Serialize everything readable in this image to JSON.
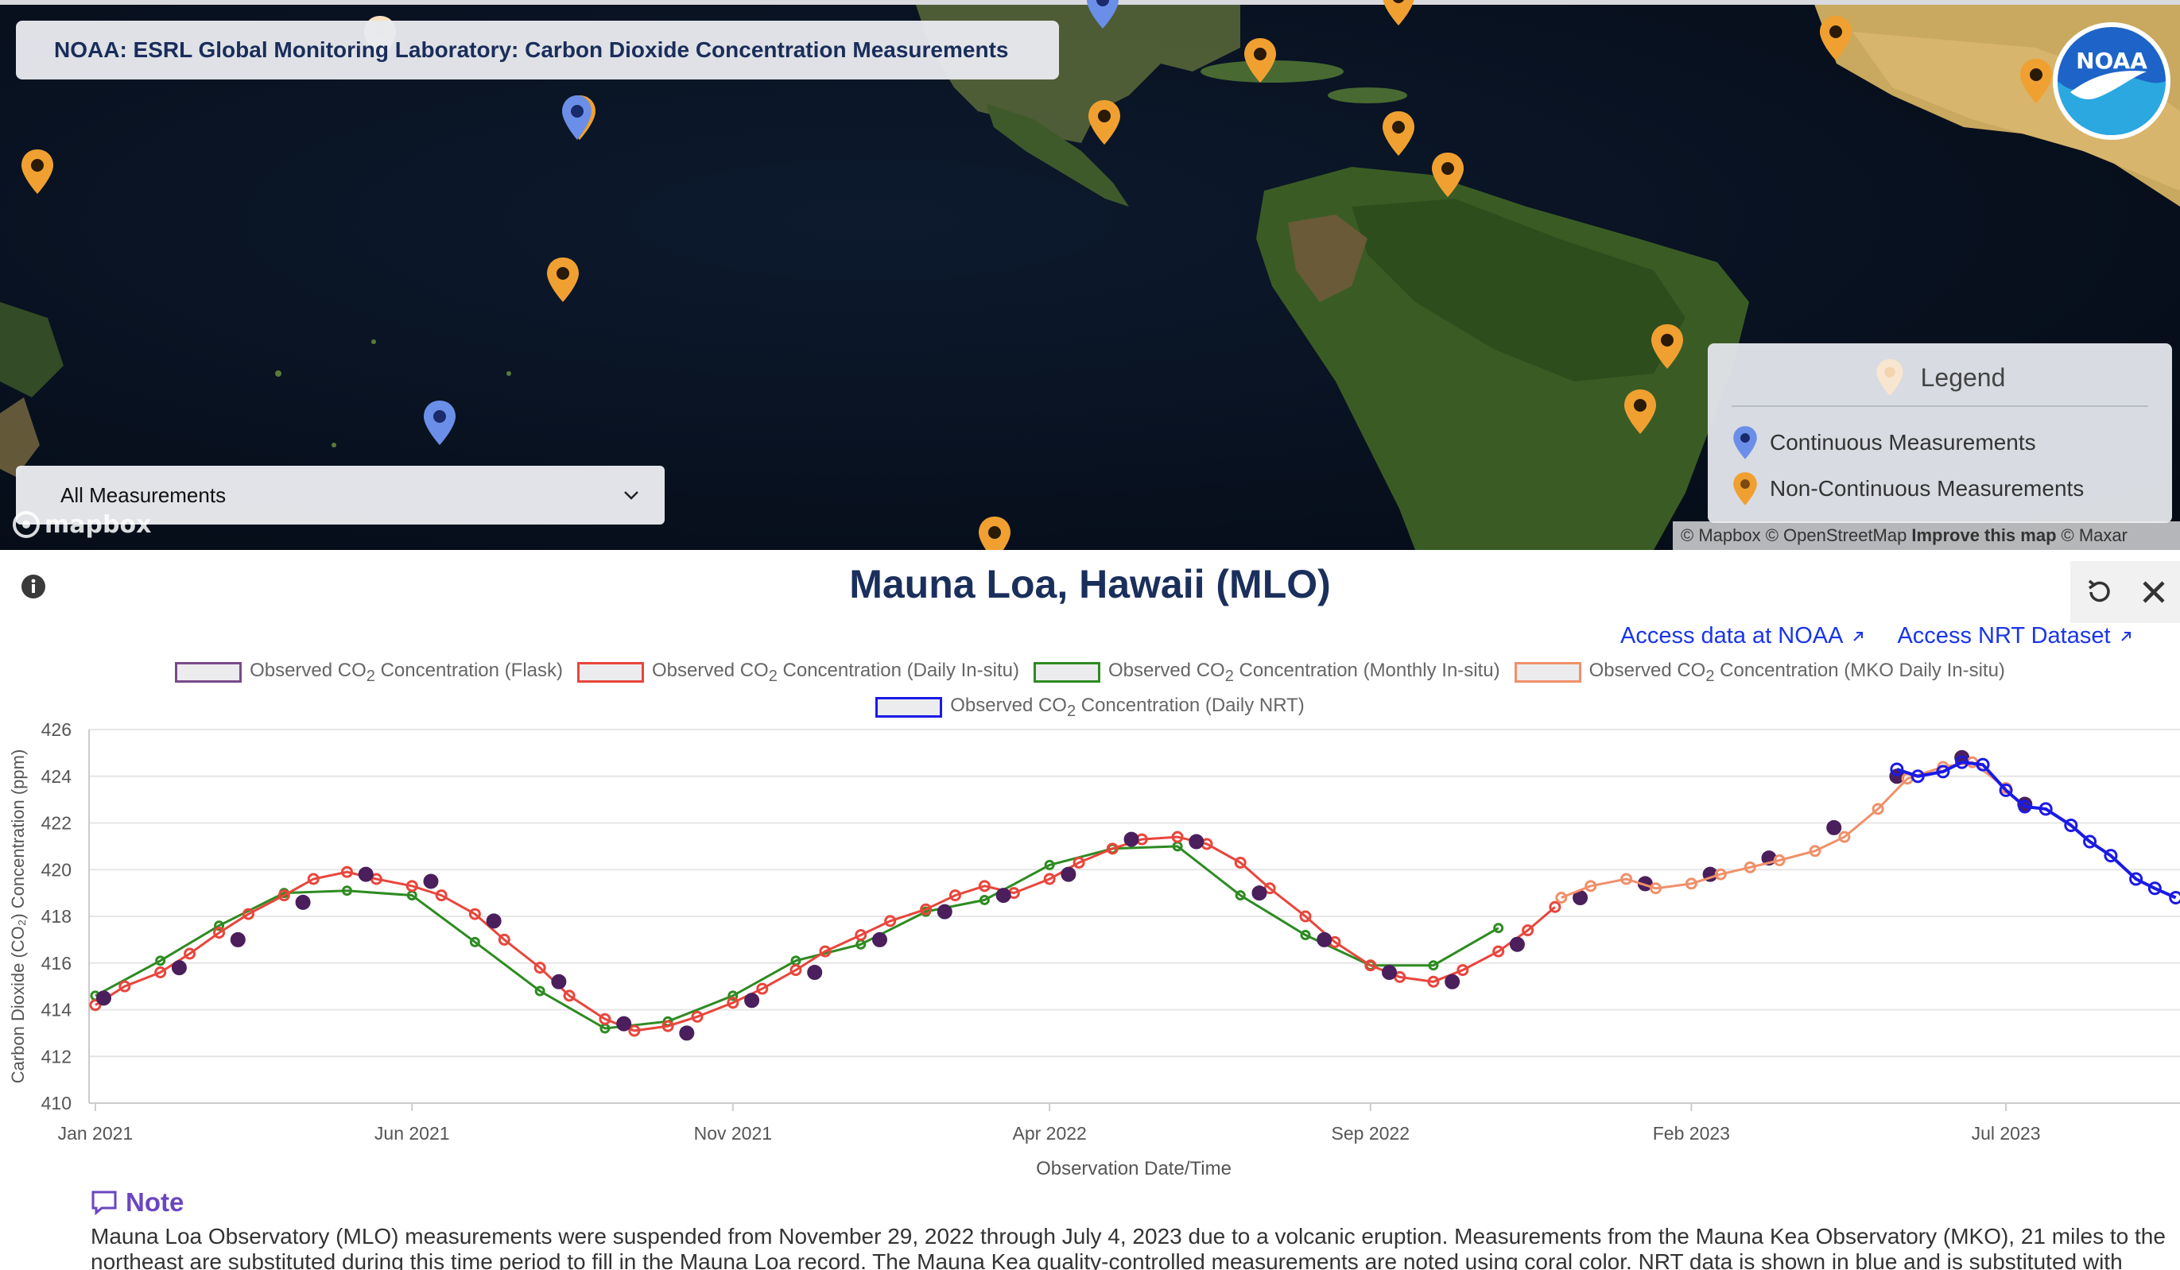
{
  "header": {
    "title": "NOAA: ESRL Global Monitoring Laboratory: Carbon Dioxide Concentration Measurements"
  },
  "logo": {
    "text": "NOAA"
  },
  "filter": {
    "selected": "All Measurements"
  },
  "map": {
    "brand": "mapbox",
    "attribution": {
      "mapbox": "© Mapbox",
      "osm": "© OpenStreetMap",
      "improve": "Improve this map",
      "maxar": "© Maxar"
    },
    "legend": {
      "title": "Legend",
      "continuous": "Continuous Measurements",
      "noncontinuous": "Non-Continuous Measurements"
    }
  },
  "colors": {
    "continuous_pin": "#6b8fe8",
    "noncontinuous_pin": "#f0a030",
    "flask": "#4a1f5c",
    "daily_insitu": "#e8463c",
    "monthly_insitu": "#2e8b22",
    "mko": "#f0906a",
    "nrt": "#1a1ae6",
    "title": "#1b2f5c",
    "link": "#1a35e8",
    "note": "#6b46c1"
  },
  "panel": {
    "station_title": "Mauna Loa, Hawaii (MLO)",
    "links": {
      "noaa": "Access data at NOAA",
      "nrt": "Access NRT Dataset"
    },
    "chart_legend": [
      {
        "prefix": "Observed CO",
        "sub": "2",
        "suffix": " Concentration (Flask)"
      },
      {
        "prefix": "Observed CO",
        "sub": "2",
        "suffix": " Concentration (Daily In-situ)"
      },
      {
        "prefix": "Observed CO",
        "sub": "2",
        "suffix": " Concentration (Monthly In-situ)"
      },
      {
        "prefix": "Observed CO",
        "sub": "2",
        "suffix": " Concentration (MKO Daily In-situ)"
      },
      {
        "prefix": "Observed CO",
        "sub": "2",
        "suffix": " Concentration (Daily NRT)"
      }
    ],
    "note": {
      "heading": "Note",
      "line1": "Mauna Loa Observatory (MLO) measurements were suspended from November 29, 2022 through July 4, 2023 due to a volcanic eruption. Measurements from the Mauna Kea Observatory (MKO), 21 miles to the",
      "line2": "northeast are substituted during this time period to fill in the Mauna Loa record. The Mauna Kea quality-controlled measurements are noted using coral color. NRT data is shown in blue and is substituted with"
    }
  },
  "chart_data": {
    "type": "line",
    "xlabel": "Observation Date/Time",
    "ylabel": "Carbon Dioxide (CO₂) Concentration (ppm)",
    "ylim": [
      410,
      426
    ],
    "yticks": [
      410,
      412,
      414,
      416,
      418,
      420,
      422,
      424,
      426
    ],
    "xlim": [
      "2020-12-29",
      "2023-09-22"
    ],
    "xticks": [
      {
        "label": "Jan 2021",
        "date": "2021-01-01"
      },
      {
        "label": "Jun 2021",
        "date": "2021-06-01"
      },
      {
        "label": "Nov 2021",
        "date": "2021-11-01"
      },
      {
        "label": "Apr 2022",
        "date": "2022-04-01"
      },
      {
        "label": "Sep 2022",
        "date": "2022-09-01"
      },
      {
        "label": "Feb 2023",
        "date": "2023-02-01"
      },
      {
        "label": "Jul 2023",
        "date": "2023-07-01"
      }
    ],
    "grid": true,
    "series": [
      {
        "name": "Observed CO2 Concentration (Monthly In-situ)",
        "x": [
          "2021-01-01",
          "2021-02-01",
          "2021-03-01",
          "2021-04-01",
          "2021-05-01",
          "2021-06-01",
          "2021-07-01",
          "2021-08-01",
          "2021-09-01",
          "2021-10-01",
          "2021-11-01",
          "2021-12-01",
          "2022-01-01",
          "2022-02-01",
          "2022-03-01",
          "2022-04-01",
          "2022-05-01",
          "2022-06-01",
          "2022-07-01",
          "2022-08-01",
          "2022-09-01",
          "2022-10-01",
          "2022-11-01"
        ],
        "values": [
          414.6,
          416.1,
          417.6,
          419.0,
          419.1,
          418.9,
          416.9,
          414.8,
          413.2,
          413.5,
          414.6,
          416.1,
          416.8,
          418.2,
          418.7,
          420.2,
          420.9,
          421.0,
          418.9,
          417.2,
          415.9,
          415.9,
          417.5
        ]
      },
      {
        "name": "Observed CO2 Concentration (Daily In-situ)",
        "x": [
          "2021-01-01",
          "2021-01-15",
          "2021-02-01",
          "2021-02-15",
          "2021-03-01",
          "2021-03-15",
          "2021-04-01",
          "2021-04-15",
          "2021-05-01",
          "2021-05-15",
          "2021-06-01",
          "2021-06-15",
          "2021-07-01",
          "2021-07-15",
          "2021-08-01",
          "2021-08-15",
          "2021-09-01",
          "2021-09-15",
          "2021-10-01",
          "2021-10-15",
          "2021-11-01",
          "2021-11-15",
          "2021-12-01",
          "2021-12-15",
          "2022-01-01",
          "2022-01-15",
          "2022-02-01",
          "2022-02-15",
          "2022-03-01",
          "2022-03-15",
          "2022-04-01",
          "2022-04-15",
          "2022-05-01",
          "2022-05-15",
          "2022-06-01",
          "2022-06-15",
          "2022-07-01",
          "2022-07-15",
          "2022-08-01",
          "2022-08-15",
          "2022-09-01",
          "2022-09-15",
          "2022-10-01",
          "2022-10-15",
          "2022-11-01",
          "2022-11-15",
          "2022-11-28"
        ],
        "values": [
          414.2,
          415.0,
          415.6,
          416.4,
          417.3,
          418.1,
          418.9,
          419.6,
          419.9,
          419.6,
          419.3,
          418.9,
          418.1,
          417.0,
          415.8,
          414.6,
          413.6,
          413.1,
          413.3,
          413.7,
          414.3,
          414.9,
          415.7,
          416.5,
          417.2,
          417.8,
          418.3,
          418.9,
          419.3,
          419.0,
          419.6,
          420.3,
          420.9,
          421.3,
          421.4,
          421.1,
          420.3,
          419.2,
          418.0,
          416.9,
          415.9,
          415.4,
          415.2,
          415.7,
          416.5,
          417.4,
          418.4
        ]
      },
      {
        "name": "Observed CO2 Concentration (Flask)",
        "x": [
          "2021-01-05",
          "2021-02-10",
          "2021-03-10",
          "2021-04-10",
          "2021-05-10",
          "2021-06-10",
          "2021-07-10",
          "2021-08-10",
          "2021-09-10",
          "2021-10-10",
          "2021-11-10",
          "2021-12-10",
          "2022-01-10",
          "2022-02-10",
          "2022-03-10",
          "2022-04-10",
          "2022-05-10",
          "2022-06-10",
          "2022-07-10",
          "2022-08-10",
          "2022-09-10",
          "2022-10-10",
          "2022-11-10",
          "2022-12-10",
          "2023-01-10",
          "2023-02-10",
          "2023-03-10",
          "2023-04-10",
          "2023-05-10",
          "2023-06-10",
          "2023-07-10"
        ],
        "values": [
          414.5,
          415.8,
          417.0,
          418.6,
          419.8,
          419.5,
          417.8,
          415.2,
          413.4,
          413.0,
          414.4,
          415.6,
          417.0,
          418.2,
          418.9,
          419.8,
          421.3,
          421.2,
          419.0,
          417.0,
          415.6,
          415.2,
          416.8,
          418.8,
          419.4,
          419.8,
          420.5,
          421.8,
          424.0,
          424.8,
          422.8
        ]
      },
      {
        "name": "Observed CO2 Concentration (MKO Daily In-situ)",
        "x": [
          "2022-12-01",
          "2022-12-15",
          "2023-01-01",
          "2023-01-15",
          "2023-02-01",
          "2023-02-15",
          "2023-03-01",
          "2023-03-15",
          "2023-04-01",
          "2023-04-15",
          "2023-05-01",
          "2023-05-15",
          "2023-06-01",
          "2023-06-15",
          "2023-07-01"
        ],
        "values": [
          418.8,
          419.3,
          419.6,
          419.2,
          419.4,
          419.8,
          420.1,
          420.4,
          420.8,
          421.4,
          422.6,
          423.9,
          424.4,
          424.6,
          423.5
        ]
      },
      {
        "name": "Observed CO2 Concentration (Daily NRT)",
        "x": [
          "2023-05-10",
          "2023-05-20",
          "2023-06-01",
          "2023-06-10",
          "2023-06-20",
          "2023-07-01",
          "2023-07-10",
          "2023-07-20",
          "2023-08-01",
          "2023-08-10",
          "2023-08-20",
          "2023-09-01",
          "2023-09-10",
          "2023-09-20"
        ],
        "values": [
          424.3,
          424.0,
          424.2,
          424.6,
          424.5,
          423.4,
          422.7,
          422.6,
          421.9,
          421.2,
          420.6,
          419.6,
          419.2,
          418.8
        ]
      }
    ]
  }
}
